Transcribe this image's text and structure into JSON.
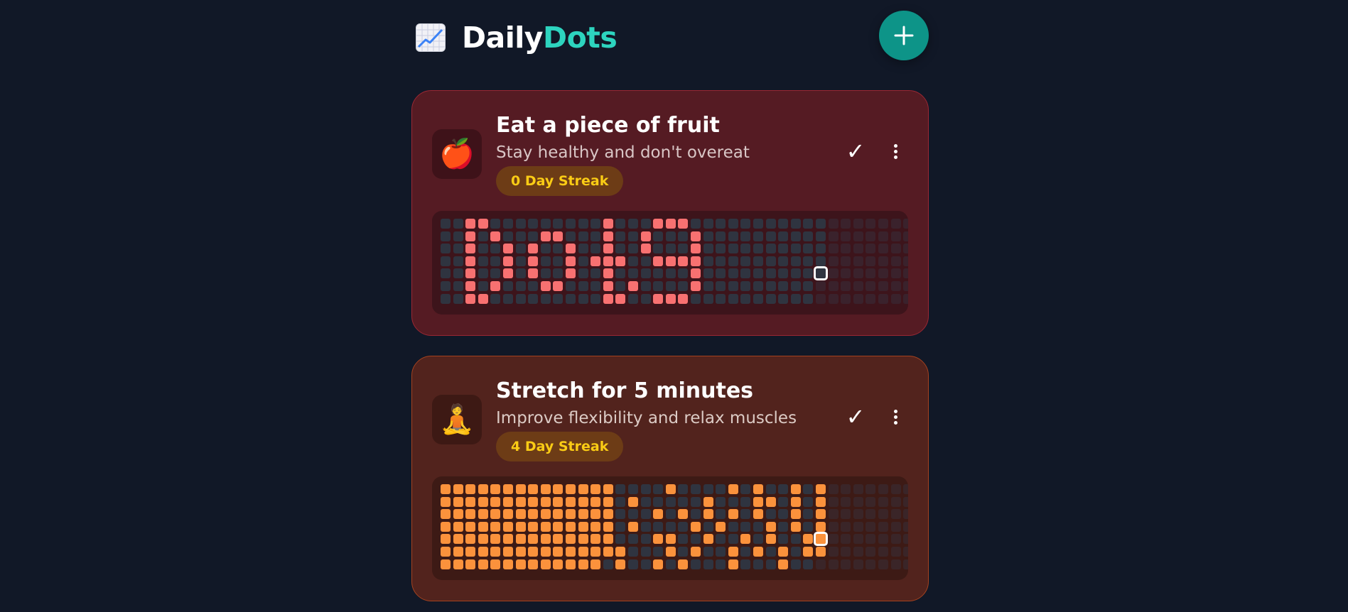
{
  "app": {
    "title_part1": "Daily",
    "title_part2": "Dots",
    "logo_icon": "chart-increasing-icon",
    "add_icon": "plus-icon",
    "accent_color": "#2dd4bf",
    "add_button_color": "#0d9488"
  },
  "habits": [
    {
      "title": "Eat a piece of fruit",
      "description": "Stay healthy and don't overeat",
      "emoji": "🍎",
      "streak_label": "0 Day Streak",
      "complete_symbol": "✓",
      "color": "#f87171",
      "grid": {
        "columns": 38,
        "rows": 7,
        "today_column": 30,
        "today_row": 4,
        "filled": [
          [
            2,
            0
          ],
          [
            3,
            0
          ],
          [
            13,
            0
          ],
          [
            17,
            0
          ],
          [
            18,
            0
          ],
          [
            19,
            0
          ],
          [
            2,
            1
          ],
          [
            4,
            1
          ],
          [
            8,
            1
          ],
          [
            9,
            1
          ],
          [
            13,
            1
          ],
          [
            16,
            1
          ],
          [
            20,
            1
          ],
          [
            2,
            2
          ],
          [
            5,
            2
          ],
          [
            7,
            2
          ],
          [
            10,
            2
          ],
          [
            13,
            2
          ],
          [
            16,
            2
          ],
          [
            20,
            2
          ],
          [
            2,
            3
          ],
          [
            5,
            3
          ],
          [
            7,
            3
          ],
          [
            10,
            3
          ],
          [
            12,
            3
          ],
          [
            13,
            3
          ],
          [
            14,
            3
          ],
          [
            17,
            3
          ],
          [
            18,
            3
          ],
          [
            19,
            3
          ],
          [
            20,
            3
          ],
          [
            2,
            4
          ],
          [
            5,
            4
          ],
          [
            7,
            4
          ],
          [
            10,
            4
          ],
          [
            13,
            4
          ],
          [
            20,
            4
          ],
          [
            2,
            5
          ],
          [
            4,
            5
          ],
          [
            8,
            5
          ],
          [
            9,
            5
          ],
          [
            13,
            5
          ],
          [
            15,
            5
          ],
          [
            20,
            5
          ],
          [
            2,
            6
          ],
          [
            3,
            6
          ],
          [
            13,
            6
          ],
          [
            14,
            6
          ],
          [
            17,
            6
          ],
          [
            18,
            6
          ],
          [
            19,
            6
          ]
        ]
      }
    },
    {
      "title": "Stretch for 5 minutes",
      "description": "Improve flexibility and relax muscles",
      "emoji": "🧘",
      "streak_label": "4 Day Streak",
      "complete_symbol": "✓",
      "color": "#fb923c",
      "grid": {
        "columns": 38,
        "rows": 7,
        "today_column": 30,
        "today_row": 4,
        "prefill_columns": 13,
        "filled": [
          [
            13,
            0
          ],
          [
            18,
            0
          ],
          [
            23,
            0
          ],
          [
            25,
            0
          ],
          [
            28,
            0
          ],
          [
            30,
            0
          ],
          [
            13,
            1
          ],
          [
            15,
            1
          ],
          [
            21,
            1
          ],
          [
            25,
            1
          ],
          [
            26,
            1
          ],
          [
            28,
            1
          ],
          [
            30,
            1
          ],
          [
            13,
            2
          ],
          [
            17,
            2
          ],
          [
            19,
            2
          ],
          [
            21,
            2
          ],
          [
            23,
            2
          ],
          [
            25,
            2
          ],
          [
            28,
            2
          ],
          [
            30,
            2
          ],
          [
            13,
            3
          ],
          [
            15,
            3
          ],
          [
            20,
            3
          ],
          [
            22,
            3
          ],
          [
            26,
            3
          ],
          [
            28,
            3
          ],
          [
            30,
            3
          ],
          [
            13,
            4
          ],
          [
            17,
            4
          ],
          [
            18,
            4
          ],
          [
            21,
            4
          ],
          [
            24,
            4
          ],
          [
            26,
            4
          ],
          [
            29,
            4
          ],
          [
            30,
            4
          ],
          [
            13,
            5
          ],
          [
            14,
            5
          ],
          [
            18,
            5
          ],
          [
            20,
            5
          ],
          [
            23,
            5
          ],
          [
            25,
            5
          ],
          [
            27,
            5
          ],
          [
            29,
            5
          ],
          [
            30,
            5
          ],
          [
            14,
            6
          ],
          [
            17,
            6
          ],
          [
            19,
            6
          ],
          [
            23,
            6
          ],
          [
            27,
            6
          ]
        ]
      }
    }
  ]
}
